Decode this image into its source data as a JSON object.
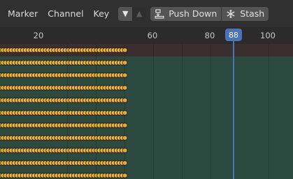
{
  "header": {
    "menus": [
      "Marker",
      "Channel",
      "Key"
    ],
    "push_down_label": "Push Down",
    "stash_label": "Stash"
  },
  "ruler": {
    "labels": [
      "20",
      "60",
      "80",
      "100"
    ],
    "current_frame": "88"
  },
  "keyframes": {
    "rows": 11,
    "last_frame": 51,
    "color": "#f5b530"
  },
  "colors": {
    "summary_row": "#3b2e2e",
    "channel_row": "#2c4a3f",
    "playhead": "#4a74b6"
  }
}
